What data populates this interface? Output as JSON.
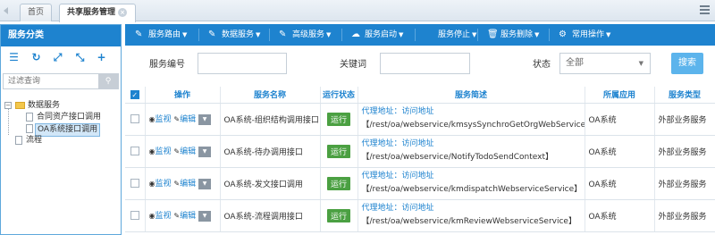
{
  "tabs": [
    {
      "label": "首页"
    },
    {
      "label": "共享服务管理",
      "close": "×"
    }
  ],
  "left": {
    "title": "服务分类",
    "search_placeholder": "过滤查询",
    "search_icon": "search-icon",
    "tree": {
      "root": "数据服务",
      "children": [
        "合同资产接口调用",
        "OA系统接口调用"
      ],
      "sibling": "流程"
    }
  },
  "toolbar": {
    "buttons": [
      {
        "label": "服务路由",
        "icon": "pencil-icon"
      },
      {
        "label": "数据服务",
        "icon": "pencil-icon"
      },
      {
        "label": "高级服务",
        "icon": "pencil-icon"
      },
      {
        "label": "服务启动",
        "icon": "cloud-upload-icon"
      },
      {
        "label": "服务停止",
        "icon": "stop-icon"
      },
      {
        "label": "服务删除",
        "icon": "trash-icon"
      },
      {
        "label": "常用操作",
        "icon": "gears-icon"
      }
    ]
  },
  "filter": {
    "code_label": "服务编号",
    "code_value": "",
    "keyword_label": "关键词",
    "keyword_value": "",
    "status_label": "状态",
    "status_value": "全部",
    "search_button": "搜索"
  },
  "table": {
    "headers": [
      "操作",
      "服务名称",
      "运行状态",
      "服务简述",
      "所属应用",
      "服务类型"
    ],
    "op_monitor": "监视",
    "op_edit": "编辑",
    "rows": [
      {
        "name": "OA系统-组织结构调用接口",
        "status": "运行",
        "proxy": "代理地址：访问地址",
        "path": "【/rest/oa/webservice/kmsysSynchroGetOrgWebService】",
        "app": "OA系统",
        "type": "外部业务服务"
      },
      {
        "name": "OA系统-待办调用接口",
        "status": "运行",
        "proxy": "代理地址：访问地址",
        "path": "【/rest/oa/webservice/NotifyTodoSendContext】",
        "app": "OA系统",
        "type": "外部业务服务"
      },
      {
        "name": "OA系统-发文接口调用",
        "status": "运行",
        "proxy": "代理地址：访问地址",
        "path": "【/rest/oa/webservice/kmdispatchWebserviceService】",
        "app": "OA系统",
        "type": "外部业务服务"
      },
      {
        "name": "OA系统-流程调用接口",
        "status": "运行",
        "proxy": "代理地址：访问地址",
        "path": "【/rest/oa/webservice/kmReviewWebserviceService】",
        "app": "OA系统",
        "type": "外部业务服务"
      }
    ]
  },
  "colors": {
    "primary": "#1e83cf",
    "status_running": "#4ba042",
    "search_button": "#5cb4ec"
  }
}
